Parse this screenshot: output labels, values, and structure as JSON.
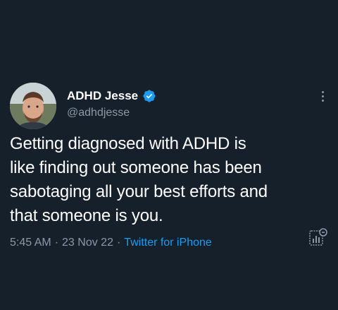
{
  "tweet": {
    "author": {
      "display_name": "ADHD Jesse",
      "handle": "@adhdjesse",
      "verified": true
    },
    "text_lines": [
      "Getting diagnosed with ADHD is",
      "like finding out someone has been",
      "sabotaging all your best efforts and",
      "that someone is you."
    ],
    "meta": {
      "time": "5:45 AM",
      "separator": "·",
      "date": "23 Nov 22",
      "source": "Twitter for iPhone"
    }
  },
  "icons": {
    "verified": "verified-badge-icon",
    "more": "more-options-icon",
    "analytics": "analytics-icon"
  },
  "colors": {
    "background": "#15202b",
    "primary_text": "#ffffff",
    "secondary_text": "#8b98a5",
    "accent": "#1d9bf0"
  }
}
